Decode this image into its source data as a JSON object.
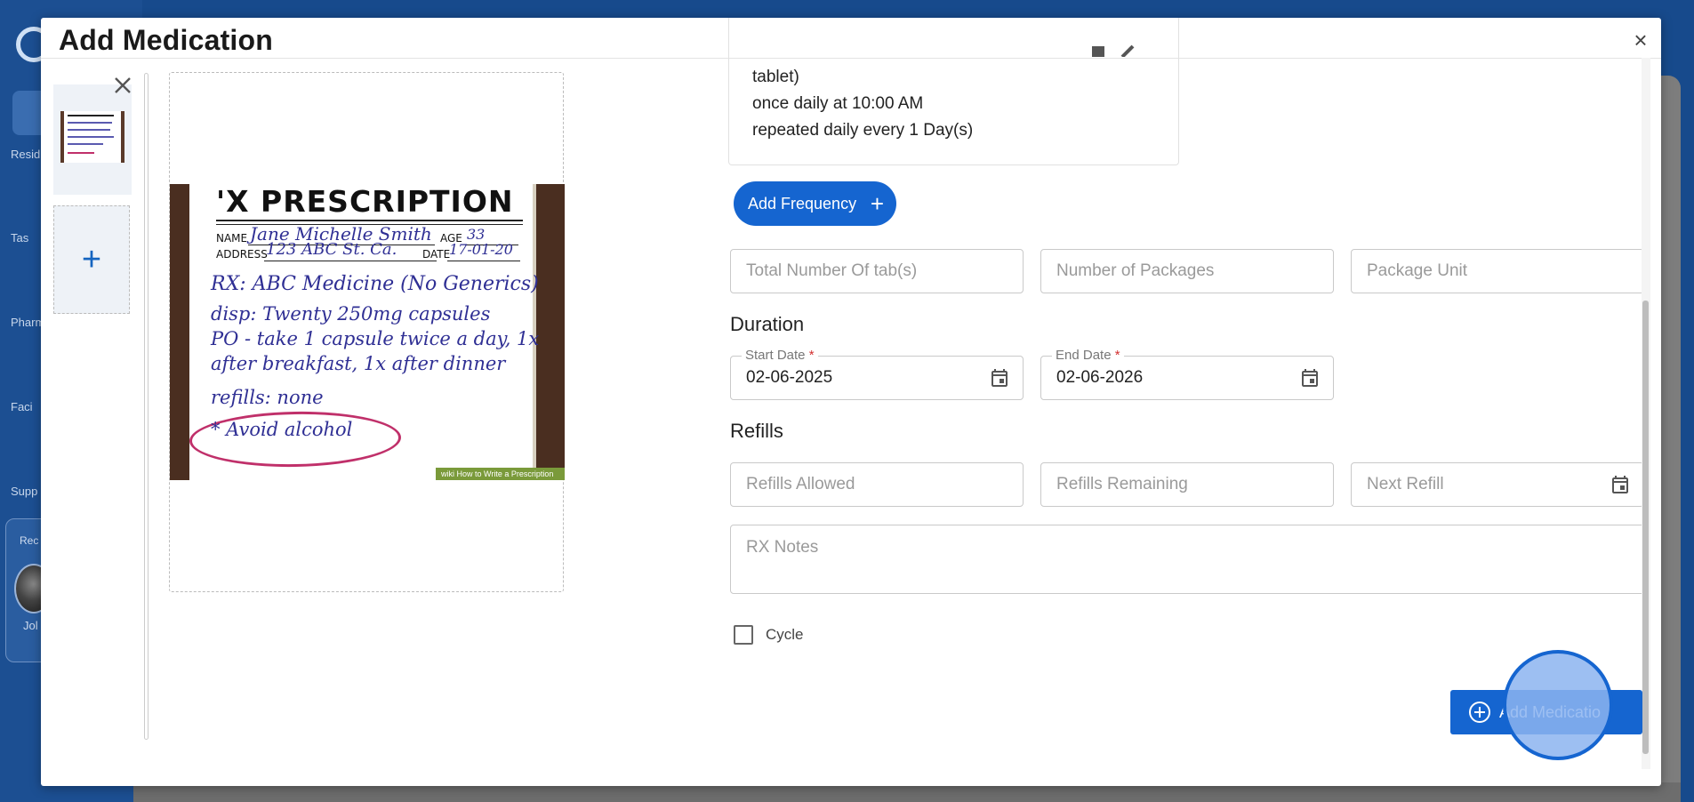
{
  "background": {
    "nav_items": [
      "Resid",
      "Tas",
      "Pharm",
      "Faci",
      "Supp"
    ],
    "recent_card": {
      "title": "Rec",
      "name": "Jol"
    }
  },
  "modal": {
    "title": "Add Medication",
    "close_glyph": "×",
    "thumbnails": {
      "add_glyph": "+"
    },
    "prescription_image": {
      "heading": "'X PRESCRIPTION",
      "name_label": "NAME",
      "name_value": "Jane Michelle Smith",
      "age_label": "AGE",
      "age_value": "33",
      "address_label": "ADDRESS",
      "address_value": "123 ABC St. Ca.",
      "date_label": "DATE",
      "date_value": "17-01-20",
      "lines": [
        "RX: ABC Medicine (No Generics)",
        "disp: Twenty 250mg capsules",
        "PO - take 1 capsule twice a day, 1x",
        "after breakfast, 1x after dinner",
        "refills: none",
        "* Avoid alcohol"
      ],
      "watermark": "wiki How to Write a Prescription"
    },
    "frequency_card": {
      "lines": [
        "tablet)",
        "once daily at 10:00 AM",
        "repeated daily every 1 Day(s)"
      ]
    },
    "add_frequency_button": {
      "label": "Add Frequency",
      "glyph": "+"
    },
    "quantity": {
      "total_tabs_placeholder": "Total Number Of tab(s)",
      "packages_placeholder": "Number of Packages",
      "package_unit_placeholder": "Package Unit"
    },
    "duration": {
      "title": "Duration",
      "start_label": "Start Date",
      "start_value": "02-06-2025",
      "end_label": "End Date",
      "end_value": "02-06-2026",
      "required_mark": "*"
    },
    "refills": {
      "title": "Refills",
      "allowed_placeholder": "Refills Allowed",
      "remaining_placeholder": "Refills Remaining",
      "next_placeholder": "Next Refill"
    },
    "rx_notes_placeholder": "RX Notes",
    "cycle_label": "Cycle",
    "add_medication_button": {
      "label": "Add Medicatio"
    }
  },
  "colors": {
    "primary": "#1565d0",
    "required": "#d32f2f",
    "background_app": "#174a8c"
  }
}
